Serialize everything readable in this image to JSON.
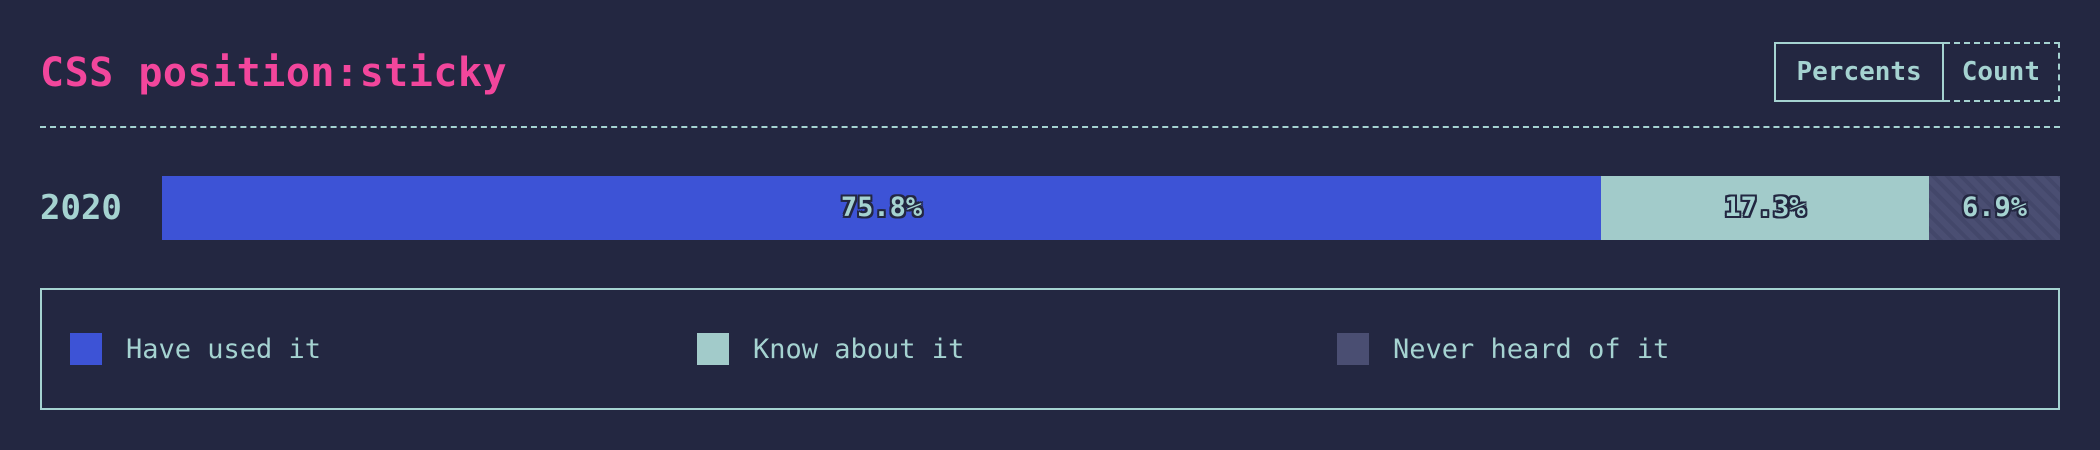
{
  "header": {
    "title": "CSS position:sticky",
    "toggle": {
      "percents_label": "Percents",
      "count_label": "Count",
      "active": "percents"
    }
  },
  "colors": {
    "background": "#232741",
    "title": "#f2469c",
    "text": "#a5d3d1",
    "used": "#3d53d6",
    "know": "#a2cbca",
    "never": "#4a4e72"
  },
  "chart_data": {
    "type": "bar",
    "orientation": "horizontal",
    "stacked": true,
    "normalized": true,
    "title": "CSS position:sticky",
    "categories": [
      "2020"
    ],
    "series": [
      {
        "name": "Have used it",
        "values": [
          75.8
        ],
        "label": "75.8%",
        "color": "#3d53d6"
      },
      {
        "name": "Know about it",
        "values": [
          17.3
        ],
        "label": "17.3%",
        "color": "#a2cbca"
      },
      {
        "name": "Never heard of it",
        "values": [
          6.9
        ],
        "label": "6.9%",
        "color": "#4a4e72",
        "pattern": "diagonal-stripes"
      }
    ],
    "xlim": [
      0,
      100
    ],
    "grid": false,
    "legend": "bottom"
  }
}
